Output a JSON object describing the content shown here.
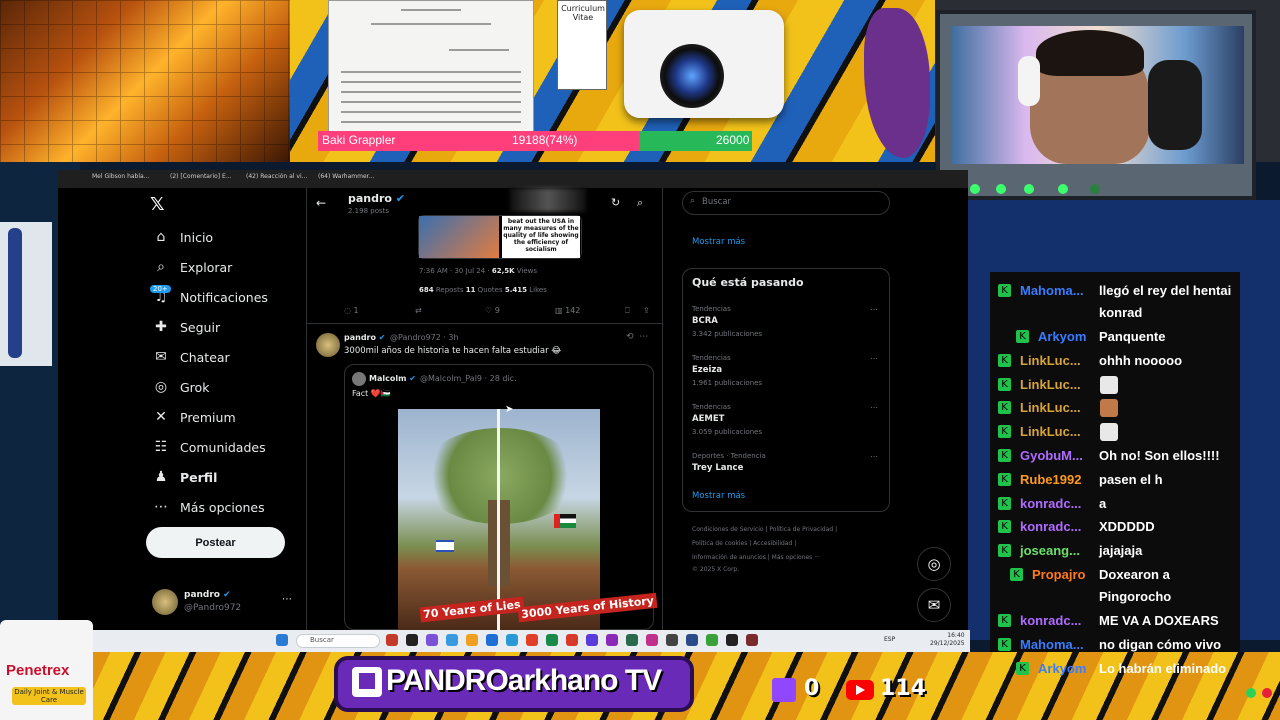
{
  "overlay": {
    "hpbar": {
      "name": "Baki Grappler",
      "value": "19188(74%)",
      "max": "26000",
      "fraction": 0.74
    },
    "cv_label": "Curriculum Vitae",
    "channel": "PANDROarkhano TV",
    "twitch_viewers": "0",
    "youtube_viewers": "114",
    "sponsor_brand": "Penetrex",
    "sponsor_sub": "Daily Joint & Muscle Care",
    "colors": {
      "hp_fill": "#ff3f7c",
      "hp_rest": "#27b85a",
      "twitch": "#9146ff",
      "youtube": "#ff0000"
    }
  },
  "browser": {
    "tabs": [
      "Mel Gibson habla...",
      "(2) [Comentario] E...",
      "(42) Reacción al vi...",
      "(64) Warhammer..."
    ]
  },
  "x": {
    "nav": [
      {
        "icon": "home-icon",
        "glyph": "⌂",
        "label": "Inicio",
        "bold": false
      },
      {
        "icon": "search-icon",
        "glyph": "⌕",
        "label": "Explorar",
        "bold": false
      },
      {
        "icon": "bell-icon",
        "glyph": "♫",
        "label": "Notificaciones",
        "bold": false
      },
      {
        "icon": "follow-icon",
        "glyph": "✚",
        "label": "Seguir",
        "bold": false
      },
      {
        "icon": "mail-icon",
        "glyph": "✉",
        "label": "Chatear",
        "bold": false
      },
      {
        "icon": "grok-icon",
        "glyph": "◎",
        "label": "Grok",
        "bold": false
      },
      {
        "icon": "x-premium-icon",
        "glyph": "✕",
        "label": "Premium",
        "bold": false
      },
      {
        "icon": "communities-icon",
        "glyph": "☷",
        "label": "Comunidades",
        "bold": false
      },
      {
        "icon": "person-icon",
        "glyph": "♟",
        "label": "Perfil",
        "bold": true
      },
      {
        "icon": "more-icon",
        "glyph": "⋯",
        "label": "Más opciones",
        "bold": false
      }
    ],
    "notif_badge": "20+",
    "post_button": "Postear",
    "account": {
      "name": "pandro",
      "handle": "@Pandro972"
    },
    "profile_header": {
      "name": "pandro",
      "posts": "2.198 posts"
    },
    "tweet1": {
      "quoted_text": "beat out the USA in many measures of the quality of life showing the efficiency of socialism",
      "time": "7:36 AM · 30 Jul 24 · ",
      "views": "62,5K",
      "views_label": " Views",
      "reposts": "684",
      "reposts_label": " Reposts  ",
      "quotes": "11",
      "quotes_label": " Quotes  ",
      "likes": "5.415",
      "likes_label": " Likes",
      "actions": {
        "reply": "1",
        "repost": "",
        "like": "9",
        "views": "142"
      }
    },
    "tweet2": {
      "name": "pandro",
      "handle": "@Pandro972 · 3h",
      "text": "3000mil años de historia te hacen falta estudiar 😂",
      "quote": {
        "name": "Malcolm",
        "handle": "@Malcolm_Pal9 · 28 dic.",
        "text": "Fact ❤️🇵🇸",
        "image_left_label": "70 Years of Lies",
        "image_right_label": "3000 Years of History"
      }
    },
    "search_placeholder": "Buscar",
    "show_more": "Mostrar más",
    "trends_title": "Qué está pasando",
    "trends": [
      {
        "category": "Tendencias",
        "name": "BCRA",
        "count": "3.342 publicaciones"
      },
      {
        "category": "Tendencias",
        "name": "Ezeiza",
        "count": "1.961 publicaciones"
      },
      {
        "category": "Tendencias",
        "name": "AEMET",
        "count": "3.059 publicaciones"
      },
      {
        "category": "Deportes · Tendencia",
        "name": "Trey Lance",
        "count": ""
      }
    ],
    "footer": [
      "Condiciones de Servicio  |  Política de Privacidad  |",
      "Política de cookies  |  Accesibilidad  |",
      "Información de anuncios  |  Más opciones ···",
      "© 2025 X Corp."
    ]
  },
  "taskbar": {
    "search_placeholder": "Buscar",
    "lang": "ESP",
    "time": "16:40",
    "date": "29/12/2025"
  },
  "chat": [
    {
      "user": "Mahoma...",
      "user_color": "#3a7bff",
      "msg": "llegó el rey del hentai",
      "msg2": "konrad"
    },
    {
      "user": "Arkyom",
      "user_color": "#3a7bff",
      "msg": "Panquente"
    },
    {
      "user": "LinkLuc...",
      "user_color": "#d7a43a",
      "msg": "ohhh nooooo"
    },
    {
      "user": "LinkLuc...",
      "user_color": "#d7a43a",
      "msg": "",
      "emoji": "#e8e8e8"
    },
    {
      "user": "LinkLuc...",
      "user_color": "#d7a43a",
      "msg": "",
      "emoji": "#c07a4a"
    },
    {
      "user": "LinkLuc...",
      "user_color": "#d7a43a",
      "msg": "",
      "emoji": "#e8e8e8"
    },
    {
      "user": "GyobuM...",
      "user_color": "#b06bff",
      "msg": "Oh no! Son ellos!!!!"
    },
    {
      "user": "Rube1992",
      "user_color": "#ff9a1a",
      "msg": "pasen el h"
    },
    {
      "user": "konradc...",
      "user_color": "#b06bff",
      "msg": "a"
    },
    {
      "user": "konradc...",
      "user_color": "#b06bff",
      "msg": "XDDDDD"
    },
    {
      "user": "joseang...",
      "user_color": "#6be06b",
      "msg": "jajajaja"
    },
    {
      "user": "Propajro",
      "user_color": "#ff7a1a",
      "msg": "Doxearon a",
      "msg2": "Pingorocho"
    },
    {
      "user": "konradc...",
      "user_color": "#b06bff",
      "msg": "ME VA A DOXEARS"
    },
    {
      "user": "Mahoma...",
      "user_color": "#3a7bff",
      "msg": "no digan cómo vivo"
    },
    {
      "user": "Arkyom",
      "user_color": "#3a7bff",
      "msg": "Lo habrán eliminado"
    }
  ]
}
